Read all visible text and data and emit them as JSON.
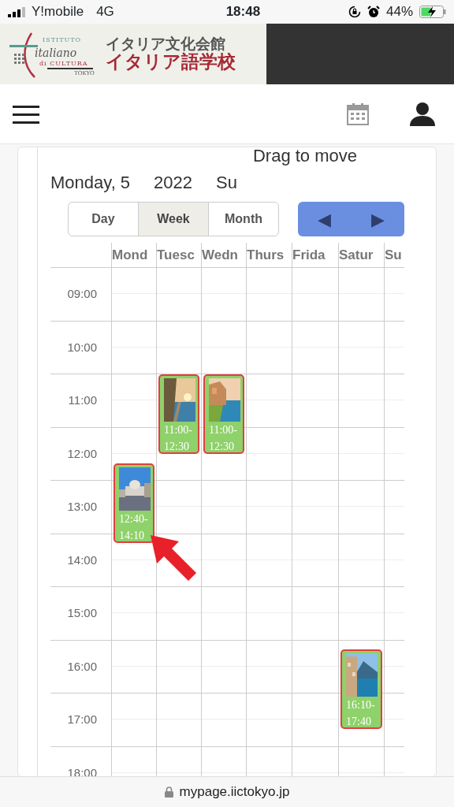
{
  "status_bar": {
    "carrier": "Y!mobile",
    "network": "4G",
    "time": "18:48",
    "battery": "44%"
  },
  "header": {
    "logo_lines": [
      "ISTITUTO",
      "italiano",
      "di CULTURA",
      "TOKYO"
    ],
    "title": "イタリア文化会館",
    "subtitle": "イタリア語学校"
  },
  "calendar": {
    "hint": "Drag to move",
    "title_parts": [
      "Monday, 5",
      "2022",
      "Su"
    ],
    "views": [
      {
        "label": "Day",
        "selected": false
      },
      {
        "label": "Week",
        "selected": true
      },
      {
        "label": "Month",
        "selected": false
      }
    ],
    "prev": "◀",
    "next": "▶",
    "hours": [
      "09:00",
      "10:00",
      "11:00",
      "12:00",
      "13:00",
      "14:00",
      "15:00",
      "16:00",
      "17:00",
      "18:00"
    ],
    "days": [
      {
        "label": "Mond",
        "events": [
          {
            "start": "12:40-",
            "end": "14:10"
          }
        ]
      },
      {
        "label": "Tuesc",
        "events": [
          {
            "start": "11:00-",
            "end": "12:30"
          }
        ]
      },
      {
        "label": "Wedn",
        "events": [
          {
            "start": "11:00-",
            "end": "12:30"
          }
        ]
      },
      {
        "label": "Thurs"
      },
      {
        "label": "Frida"
      },
      {
        "label": "Satur",
        "events": [
          {
            "start": "16:10-",
            "end": "17:40"
          }
        ]
      },
      {
        "label": "Su"
      }
    ]
  },
  "address_bar": {
    "url": "mypage.iictokyo.jp"
  }
}
